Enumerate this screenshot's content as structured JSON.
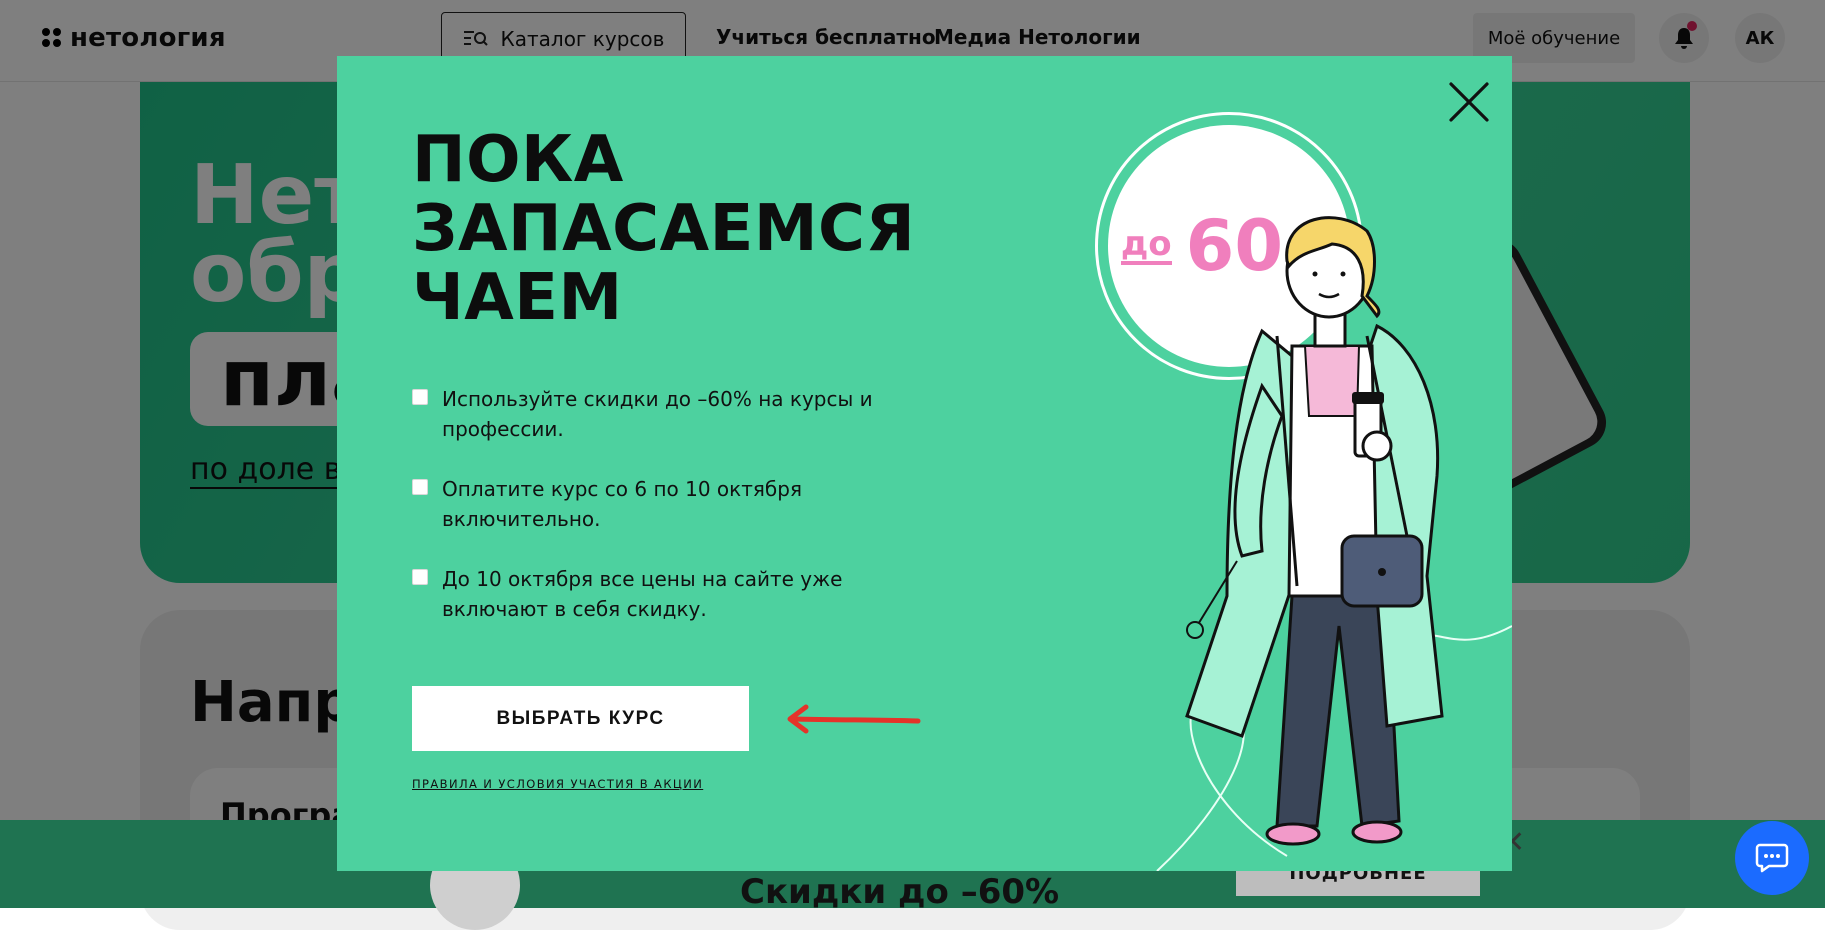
{
  "header": {
    "logo_text": "нетология",
    "catalog_label": "Каталог курсов",
    "nav": [
      "Учиться бесплатно",
      "Медиа Нетологии"
    ],
    "my_learning_label": "Моё обучение",
    "avatar_initials": "АК"
  },
  "hero": {
    "title_line1": "Нет",
    "title_line2": "обр",
    "pill_text": "пла",
    "link_text": "по доле вы"
  },
  "section": {
    "title": "Напра",
    "card_text": "Програ"
  },
  "promo_bar": {
    "title": "Скидки до –60%",
    "button_label": "ПОДРОБНЕЕ"
  },
  "modal": {
    "title_lines": [
      "ПОКА",
      "ЗАПАСАЕМСЯ",
      "ЧАЕМ"
    ],
    "bullets": [
      "Используйте скидки до –60% на курсы и профессии.",
      "Оплатите курс со 6 по 10 октября включительно.",
      "До 10 октября все цены на сайте уже включают в себя скидку."
    ],
    "cta_label": "ВЫБРАТЬ КУРС",
    "rules_link": "ПРАВИЛА И УСЛОВИЯ УЧАСТИЯ В АКЦИИ",
    "badge": {
      "prefix": "до",
      "value": "60",
      "suffix": "%"
    }
  },
  "colors": {
    "modal_bg": "#4dd19f",
    "badge_pink": "#f07fbd",
    "chat_blue": "#1b6bff",
    "arrow_red": "#e5332a"
  },
  "icons": [
    "catalog-search-icon",
    "bell-icon",
    "close-icon",
    "chat-icon",
    "arrow-left-icon"
  ]
}
